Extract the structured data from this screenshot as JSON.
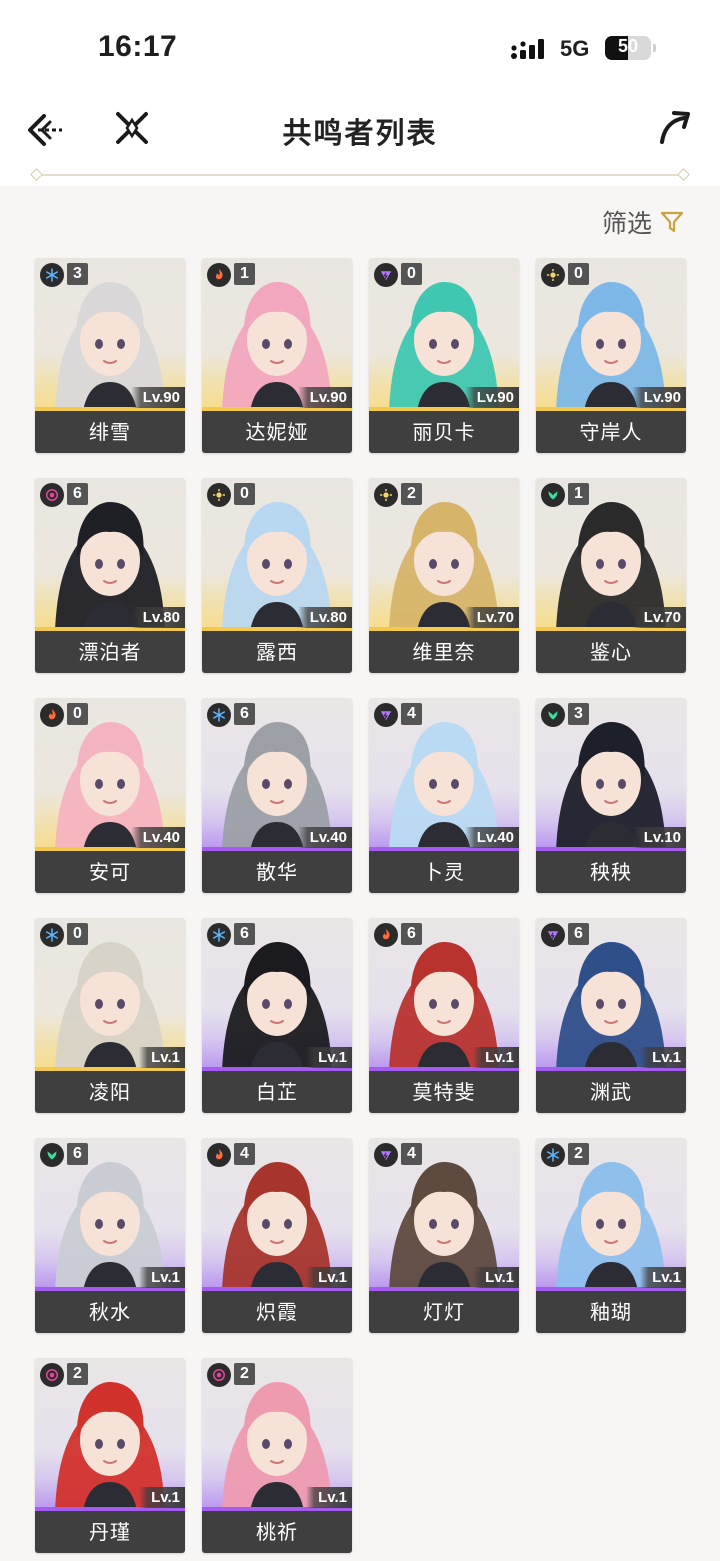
{
  "status_bar": {
    "time": "16:17",
    "network": "5G",
    "battery": "50",
    "battery_level": 0.5
  },
  "header": {
    "title": "共鸣者列表"
  },
  "filter": {
    "label": "筛选"
  },
  "colors": {
    "gold": "#f2c94c",
    "purple": "#a45cf0",
    "accent": "#c9a340"
  },
  "characters": [
    {
      "name": "绯雪",
      "level": "Lv.90",
      "chain": "3",
      "element": "glacio",
      "rarity": "gold",
      "hair": "#d9d7d8"
    },
    {
      "name": "达妮娅",
      "level": "Lv.90",
      "chain": "1",
      "element": "fusion",
      "rarity": "gold",
      "hair": "#f2a7bf"
    },
    {
      "name": "丽贝卡",
      "level": "Lv.90",
      "chain": "0",
      "element": "electro",
      "rarity": "gold",
      "hair": "#3fc7b1"
    },
    {
      "name": "守岸人",
      "level": "Lv.90",
      "chain": "0",
      "element": "spectro",
      "rarity": "gold",
      "hair": "#7db8e8"
    },
    {
      "name": "漂泊者",
      "level": "Lv.80",
      "chain": "6",
      "element": "havoc",
      "rarity": "gold",
      "hair": "#1f1f26"
    },
    {
      "name": "露西",
      "level": "Lv.80",
      "chain": "0",
      "element": "spectro",
      "rarity": "gold",
      "hair": "#b8d7f0"
    },
    {
      "name": "维里奈",
      "level": "Lv.70",
      "chain": "2",
      "element": "spectro",
      "rarity": "gold",
      "hair": "#d6b46a"
    },
    {
      "name": "鉴心",
      "level": "Lv.70",
      "chain": "1",
      "element": "aero",
      "rarity": "gold",
      "hair": "#2a2a2a"
    },
    {
      "name": "安可",
      "level": "Lv.40",
      "chain": "0",
      "element": "fusion",
      "rarity": "gold",
      "hair": "#f4b3c0"
    },
    {
      "name": "散华",
      "level": "Lv.40",
      "chain": "6",
      "element": "glacio",
      "rarity": "purple",
      "hair": "#9c9fa6"
    },
    {
      "name": "卜灵",
      "level": "Lv.40",
      "chain": "4",
      "element": "electro",
      "rarity": "purple",
      "hair": "#b9daf2"
    },
    {
      "name": "秧秧",
      "level": "Lv.10",
      "chain": "3",
      "element": "aero",
      "rarity": "purple",
      "hair": "#1d1f2b"
    },
    {
      "name": "凌阳",
      "level": "Lv.1",
      "chain": "0",
      "element": "glacio",
      "rarity": "gold",
      "hair": "#d8d3c8"
    },
    {
      "name": "白芷",
      "level": "Lv.1",
      "chain": "6",
      "element": "glacio",
      "rarity": "purple",
      "hair": "#1b1b1f"
    },
    {
      "name": "莫特斐",
      "level": "Lv.1",
      "chain": "6",
      "element": "fusion",
      "rarity": "purple",
      "hair": "#b8332e"
    },
    {
      "name": "渊武",
      "level": "Lv.1",
      "chain": "6",
      "element": "electro",
      "rarity": "purple",
      "hair": "#2f4f8a"
    },
    {
      "name": "秋水",
      "level": "Lv.1",
      "chain": "6",
      "element": "aero",
      "rarity": "purple",
      "hair": "#c9ccd3"
    },
    {
      "name": "炽霞",
      "level": "Lv.1",
      "chain": "4",
      "element": "fusion",
      "rarity": "purple",
      "hair": "#a8352c"
    },
    {
      "name": "灯灯",
      "level": "Lv.1",
      "chain": "4",
      "element": "electro",
      "rarity": "purple",
      "hair": "#5f4a3f"
    },
    {
      "name": "釉瑚",
      "level": "Lv.1",
      "chain": "2",
      "element": "glacio",
      "rarity": "purple",
      "hair": "#8fc0ec"
    },
    {
      "name": "丹瑾",
      "level": "Lv.1",
      "chain": "2",
      "element": "havoc",
      "rarity": "purple",
      "hair": "#d2322c"
    },
    {
      "name": "桃祈",
      "level": "Lv.1",
      "chain": "2",
      "element": "havoc",
      "rarity": "purple",
      "hair": "#ee9bb0"
    }
  ],
  "element_icons": {
    "glacio": {
      "icon": "snowflake-icon",
      "color": "#5fb8ff"
    },
    "fusion": {
      "icon": "flame-icon",
      "color": "#ff6b3d"
    },
    "electro": {
      "icon": "lightning-icon",
      "color": "#b675ff"
    },
    "spectro": {
      "icon": "sun-icon",
      "color": "#f3d36b"
    },
    "havoc": {
      "icon": "spiral-icon",
      "color": "#e0479c"
    },
    "aero": {
      "icon": "wind-icon",
      "color": "#3fdc9b"
    }
  }
}
